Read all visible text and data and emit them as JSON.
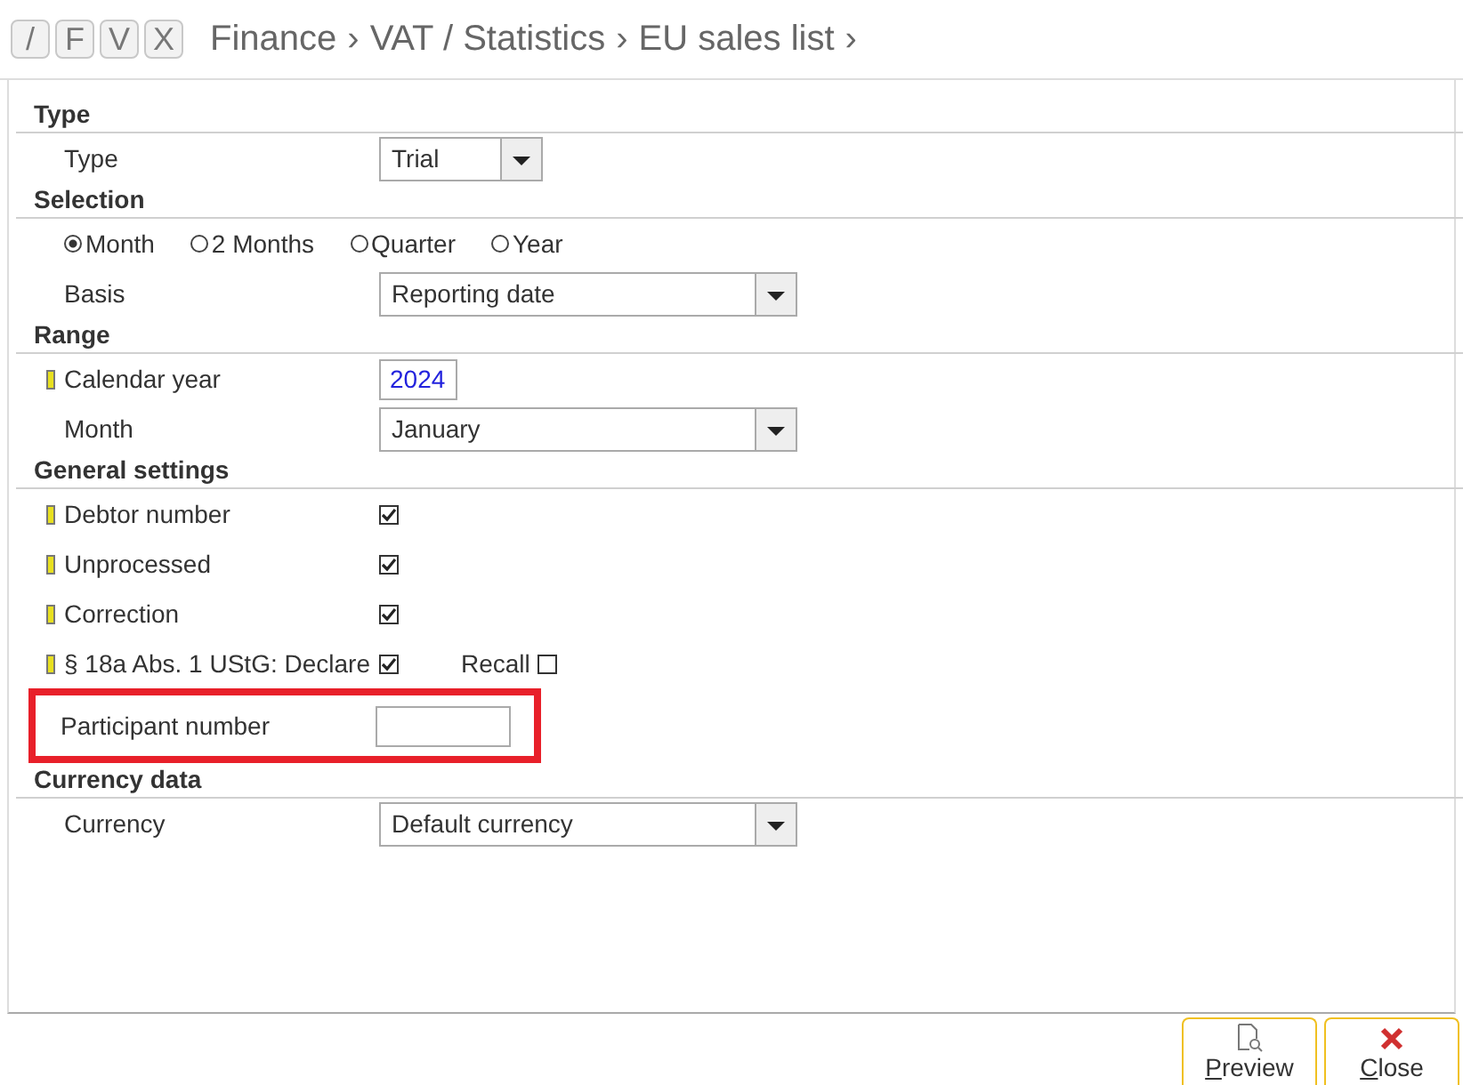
{
  "toolbar": {
    "keys": [
      "/",
      "F",
      "V",
      "X"
    ],
    "breadcrumb": [
      "Finance",
      "VAT / Statistics",
      "EU sales list"
    ],
    "separator": "›"
  },
  "sections": [
    {
      "heading": "Type",
      "rows": [
        {
          "kind": "small_dropdown",
          "label": "Type",
          "value": "Trial",
          "required": false,
          "highlighted": false
        }
      ]
    },
    {
      "heading": "Selection",
      "rows": [
        {
          "kind": "radio",
          "options": [
            {
              "label": "Month",
              "selected": true
            },
            {
              "label": "2 Months",
              "selected": false
            },
            {
              "label": "Quarter",
              "selected": false
            },
            {
              "label": "Year",
              "selected": false
            }
          ]
        },
        {
          "kind": "dropdown",
          "label": "Basis",
          "value": "Reporting date",
          "required": false,
          "highlighted": false
        }
      ]
    },
    {
      "heading": "Range",
      "rows": [
        {
          "kind": "text",
          "label": "Calendar year",
          "value": "2024",
          "required": true,
          "highlighted": false
        },
        {
          "kind": "dropdown",
          "label": "Month",
          "value": "January",
          "required": false,
          "highlighted": false
        }
      ]
    },
    {
      "heading": "General settings",
      "rows": [
        {
          "kind": "checkbox",
          "label": "Debtor number",
          "checked": true,
          "required": true,
          "highlighted": false
        },
        {
          "kind": "checkbox",
          "label": "Unprocessed",
          "checked": true,
          "required": true,
          "highlighted": false
        },
        {
          "kind": "checkbox",
          "label": "Correction",
          "checked": true,
          "required": true,
          "highlighted": false
        },
        {
          "kind": "checkbox",
          "label": "§ 18a Abs. 1 UStG: Declare",
          "checked": true,
          "required": true,
          "highlighted": false,
          "extra": {
            "label": "Recall",
            "checked": false
          }
        },
        {
          "kind": "text",
          "label": "Participant number",
          "value": "",
          "required": false,
          "highlighted": true
        }
      ]
    },
    {
      "heading": "Currency data",
      "rows": [
        {
          "kind": "dropdown",
          "label": "Currency",
          "value": "Default currency",
          "required": false,
          "highlighted": false
        }
      ]
    }
  ],
  "buttons": [
    {
      "kind": "preview",
      "label": "Preview",
      "access_key_underlined": true
    },
    {
      "kind": "close",
      "label": "Close",
      "access_key_underlined": true
    }
  ]
}
